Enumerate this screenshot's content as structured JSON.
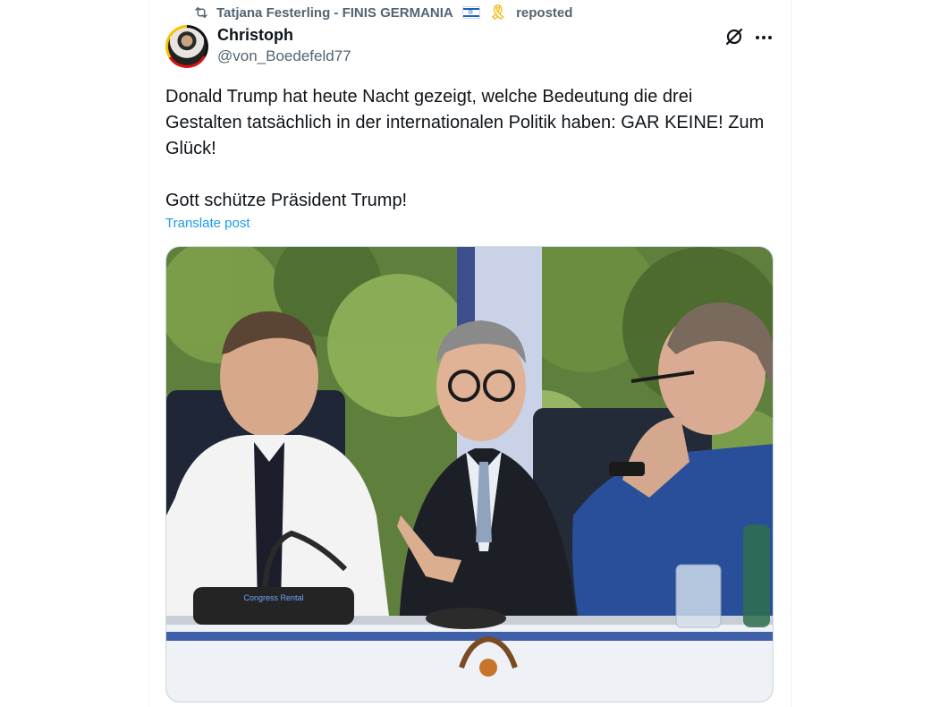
{
  "repost": {
    "reposter_name": "Tatjana Festerling - FINIS GERMANIA",
    "suffix": "reposted",
    "icon": "repost-icon"
  },
  "author": {
    "name": "Christoph",
    "handle": "@von_Boedefeld77"
  },
  "post": {
    "text": "Donald Trump hat heute Nacht gezeigt, welche Bedeutung die drei Gestalten tatsächlich in der internationalen Politik haben: GAR KEINE! Zum Glück!\n\nGott schütze Präsident Trump!",
    "translate_label": "Translate post"
  },
  "media": {
    "mic_label": "Congress Rental"
  },
  "icons": {
    "grok": "grok-icon",
    "more": "more-icon"
  },
  "colors": {
    "link": "#1d9bf0",
    "secondary_text": "#536471"
  }
}
